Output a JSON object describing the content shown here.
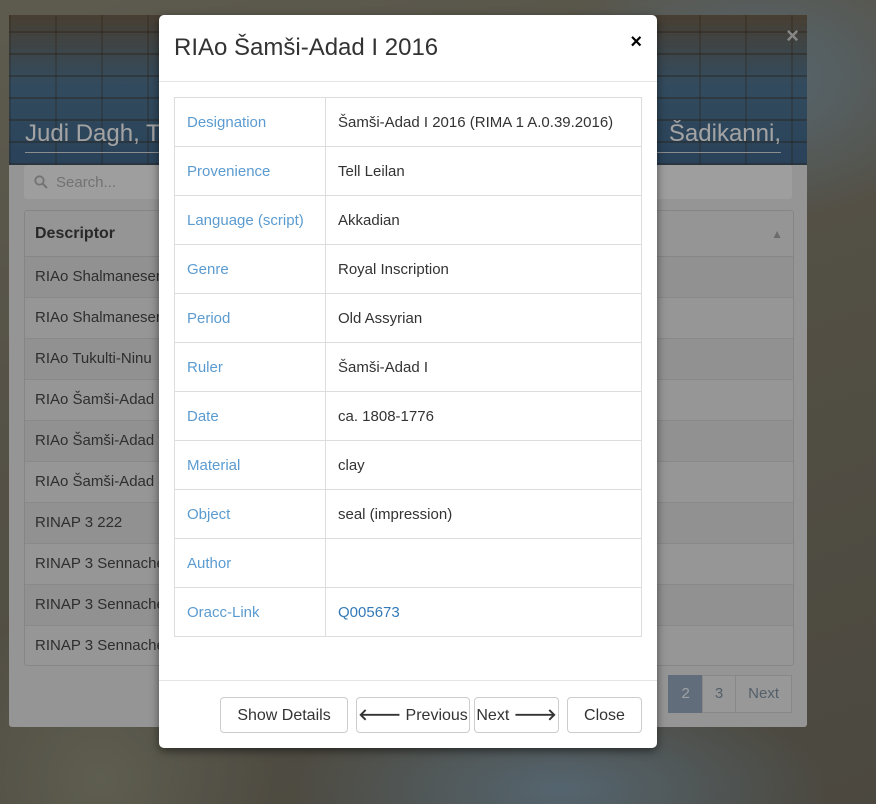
{
  "background": {
    "banner_title_left": "Judi Dagh, T",
    "banner_title_right": "Šadikanni,",
    "close_symbol": "×",
    "search_placeholder": "Search...",
    "table_header": "Descriptor",
    "rows": [
      "RIAo Shalmaneser",
      "RIAo Shalmaneser",
      "RIAo Tukulti-Ninu",
      "RIAo Šamši-Adad",
      "RIAo Šamši-Adad",
      "RIAo Šamši-Adad",
      "RINAP 3 222",
      "RINAP 3 Sennache",
      "RINAP 3 Sennache",
      "RINAP 3 Sennache"
    ],
    "pagination": [
      "2",
      "3",
      "Next"
    ],
    "active_page": "2"
  },
  "modal": {
    "title": "RIAo Šamši-Adad I 2016",
    "close_symbol": "×",
    "fields": [
      {
        "key": "Designation",
        "value": "Šamši-Adad I 2016 (RIMA 1 A.0.39.2016)"
      },
      {
        "key": "Provenience",
        "value": "Tell Leilan"
      },
      {
        "key": "Language (script)",
        "value": "Akkadian"
      },
      {
        "key": "Genre",
        "value": "Royal Inscription"
      },
      {
        "key": "Period",
        "value": "Old Assyrian"
      },
      {
        "key": "Ruler",
        "value": "Šamši-Adad I"
      },
      {
        "key": "Date",
        "value": "ca. 1808-1776"
      },
      {
        "key": "Material",
        "value": "clay"
      },
      {
        "key": "Object",
        "value": "seal (impression)"
      },
      {
        "key": "Author",
        "value": ""
      },
      {
        "key": "Oracc-Link",
        "value": "Q005673"
      }
    ],
    "buttons": {
      "show_details": "Show Details",
      "previous": "Previous",
      "next": "Next",
      "close": "Close"
    }
  },
  "colors": {
    "key_text": "#5b9bd0",
    "link": "#337ab7",
    "active_page_bg": "#8fa1b5"
  }
}
